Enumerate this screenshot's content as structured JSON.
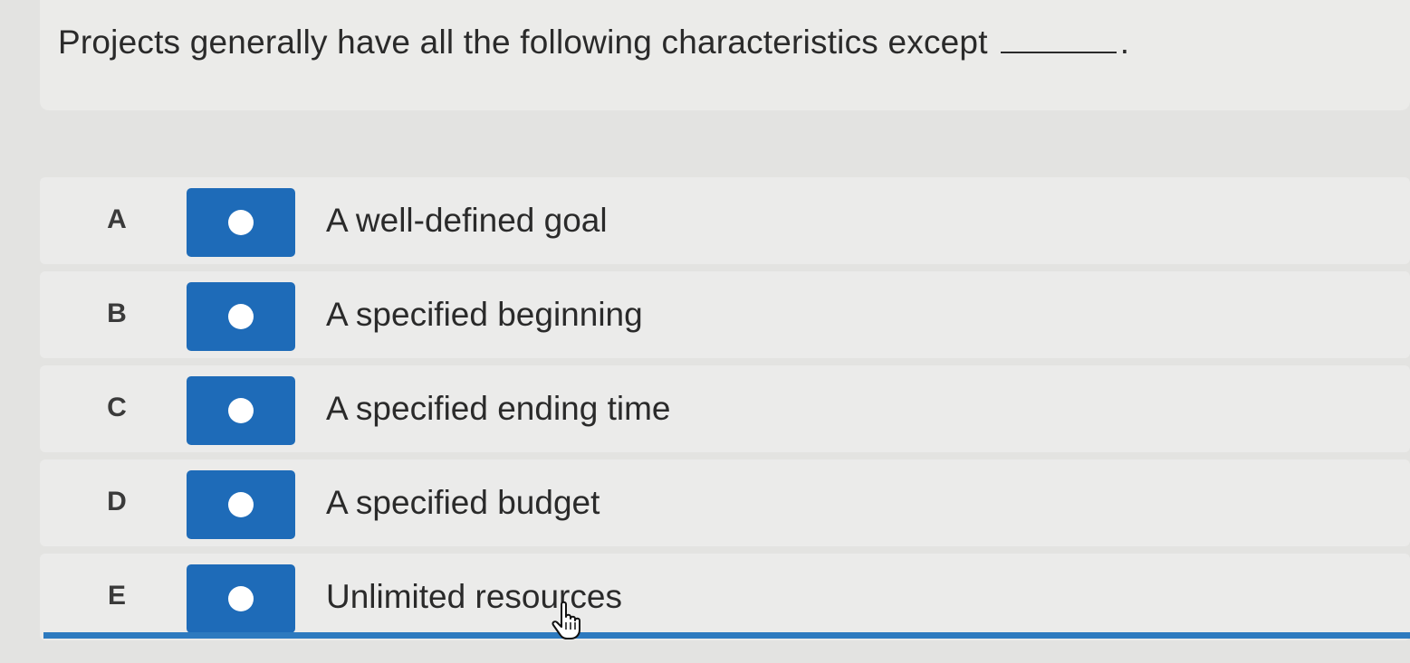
{
  "question": {
    "text": "Projects generally have all the following characteristics except",
    "end_punct": "."
  },
  "options": [
    {
      "letter": "A",
      "label": "A well-defined goal"
    },
    {
      "letter": "B",
      "label": "A specified beginning"
    },
    {
      "letter": "C",
      "label": "A specified ending time"
    },
    {
      "letter": "D",
      "label": "A specified budget"
    },
    {
      "letter": "E",
      "label": "Unlimited resources"
    }
  ],
  "colors": {
    "radio_box": "#1e6bb8",
    "accent_bar": "#2d7abf"
  }
}
